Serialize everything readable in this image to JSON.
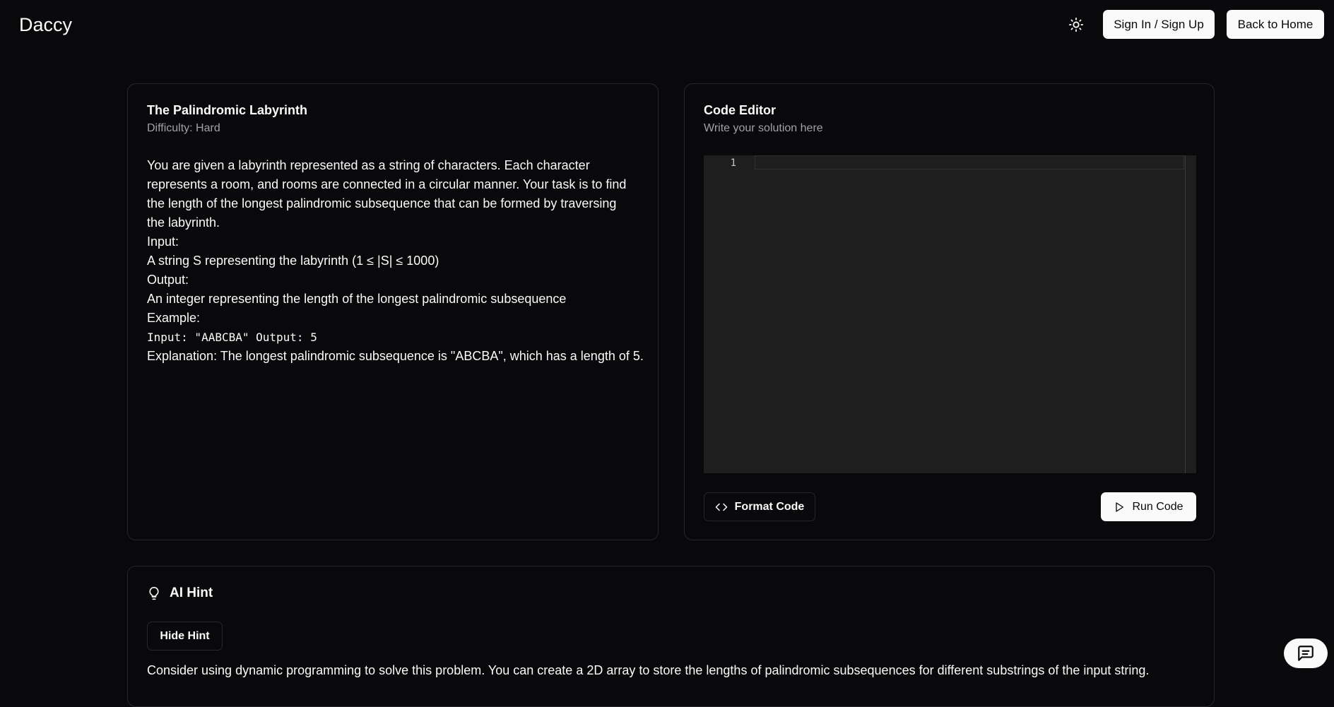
{
  "header": {
    "logo": "Daccy",
    "theme_icon": "sun-icon",
    "signin_label": "Sign In / Sign Up",
    "home_label": "Back to Home"
  },
  "problem": {
    "title": "The Palindromic Labyrinth",
    "difficulty": "Difficulty: Hard",
    "lines": [
      "You are given a labyrinth represented as a string of characters. Each character",
      "represents a room, and rooms are connected in a circular manner. Your task is to find",
      "the length of the longest palindromic subsequence that can be formed by traversing",
      "the labyrinth.",
      "Input:",
      "A string S representing the labyrinth (1 ≤ |S| ≤ 1000)",
      "Output:",
      "An integer representing the length of the longest palindromic subsequence",
      "Example:"
    ],
    "example_code": "Input: \"AABCBA\" Output: 5",
    "explanation": "Explanation: The longest palindromic subsequence is \"ABCBA\", which has a length of 5."
  },
  "editor": {
    "title": "Code Editor",
    "subtitle": "Write your solution here",
    "line_number": "1",
    "format_label": "Format Code",
    "format_icon": "code-icon",
    "run_label": "Run Code",
    "run_icon": "play-icon"
  },
  "hint": {
    "title": "AI Hint",
    "icon": "lightbulb-icon",
    "hide_label": "Hide Hint",
    "text": "Consider using dynamic programming to solve this problem. You can create a 2D array to store the lengths of palindromic subsequences for different substrings of the input string."
  },
  "chat": {
    "icon": "chat-icon"
  }
}
